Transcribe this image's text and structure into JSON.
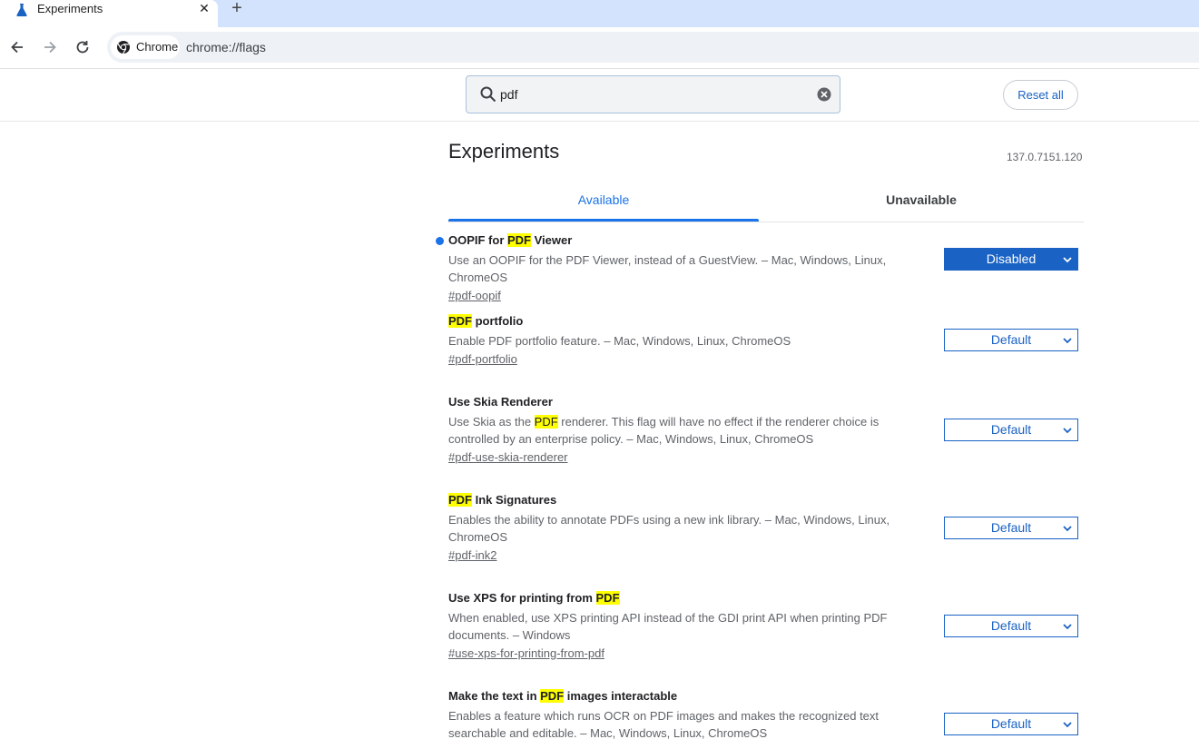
{
  "browser": {
    "tab_title": "Experiments",
    "chip_label": "Chrome",
    "url": "chrome://flags"
  },
  "header": {
    "search_value": "pdf",
    "reset_label": "Reset all"
  },
  "main": {
    "title": "Experiments",
    "version": "137.0.7151.120",
    "tabs": [
      {
        "label": "Available",
        "selected": true
      },
      {
        "label": "Unavailable",
        "selected": false
      }
    ]
  },
  "flags": [
    {
      "title_before": "OOPIF for ",
      "title_hl": "PDF",
      "title_after": " Viewer",
      "desc_before": "Use an OOPIF for the PDF Viewer, instead of a GuestView. – Mac, Windows, Linux, ChromeOS",
      "desc_hl": "",
      "desc_after": "",
      "link": "#pdf-oopif",
      "value": "Disabled",
      "modified": true
    },
    {
      "title_before": "",
      "title_hl": "PDF",
      "title_after": " portfolio",
      "desc_before": "Enable PDF portfolio feature. – Mac, Windows, Linux, ChromeOS",
      "desc_hl": "",
      "desc_after": "",
      "link": "#pdf-portfolio",
      "value": "Default",
      "modified": false
    },
    {
      "title_before": "Use Skia Renderer",
      "title_hl": "",
      "title_after": "",
      "desc_before": "Use Skia as the ",
      "desc_hl": "PDF",
      "desc_after": " renderer. This flag will have no effect if the renderer choice is controlled by an enterprise policy. – Mac, Windows, Linux, ChromeOS",
      "link": "#pdf-use-skia-renderer",
      "value": "Default",
      "modified": false
    },
    {
      "title_before": "",
      "title_hl": "PDF",
      "title_after": " Ink Signatures",
      "desc_before": "Enables the ability to annotate PDFs using a new ink library. – Mac, Windows, Linux, ChromeOS",
      "desc_hl": "",
      "desc_after": "",
      "link": "#pdf-ink2",
      "value": "Default",
      "modified": false
    },
    {
      "title_before": "Use XPS for printing from ",
      "title_hl": "PDF",
      "title_after": "",
      "desc_before": "When enabled, use XPS printing API instead of the GDI print API when printing PDF documents. – Windows",
      "desc_hl": "",
      "desc_after": "",
      "link": "#use-xps-for-printing-from-pdf",
      "value": "Default",
      "modified": false
    },
    {
      "title_before": "Make the text in ",
      "title_hl": "PDF",
      "title_after": " images interactable",
      "desc_before": "Enables a feature which runs OCR on PDF images and makes the recognized text searchable and editable. – Mac, Windows, Linux, ChromeOS",
      "desc_hl": "",
      "desc_after": "",
      "link": "",
      "value": "Default",
      "modified": false
    }
  ],
  "colors": {
    "accent": "#1a73e8",
    "select_border": "#1a62c4",
    "highlight": "#ffff00",
    "tabstrip_bg": "#d3e3fd"
  },
  "icons": {
    "tab_favicon": "flask-icon",
    "tab_close": "close-icon",
    "new_tab": "plus-icon",
    "back": "back-arrow-icon",
    "forward": "forward-arrow-icon",
    "reload": "reload-icon",
    "chip": "chrome-logo-icon",
    "search": "search-icon",
    "clear": "clear-icon",
    "select_caret": "chevron-down-icon"
  }
}
